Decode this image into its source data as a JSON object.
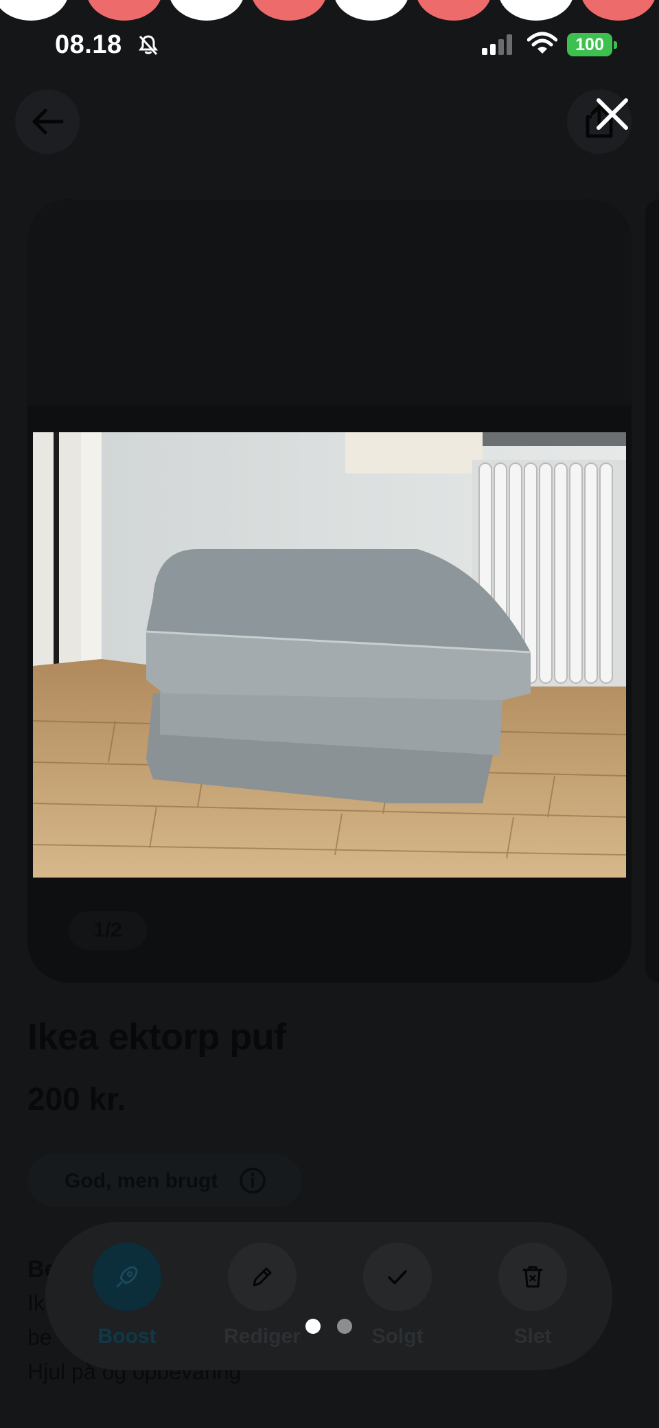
{
  "status_bar": {
    "time": "08.18",
    "battery": "100"
  },
  "listing": {
    "image_counter": "1/2",
    "title": "Ikea ektorp puf",
    "price": "200 kr.",
    "condition": "God, men brugt",
    "description_heading": "Be",
    "description_lines": [
      "Ik",
      "be",
      "Hjul på og opbevaring"
    ]
  },
  "actions": [
    {
      "label": "Boost",
      "icon": "rocket-icon"
    },
    {
      "label": "Rediger",
      "icon": "pencil-icon"
    },
    {
      "label": "Solgt",
      "icon": "check-icon"
    },
    {
      "label": "Slet",
      "icon": "trash-icon"
    }
  ],
  "pager": {
    "current": 1,
    "total": 2
  },
  "colors": {
    "accent_dark": "#0c2d3a",
    "battery_green": "#3ec04f",
    "decor_red": "#ee6b6b"
  }
}
